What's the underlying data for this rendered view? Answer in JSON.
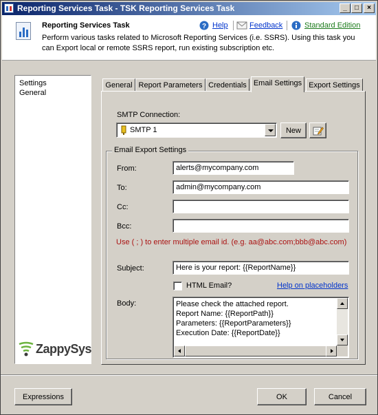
{
  "window": {
    "title": "Reporting Services Task - TSK Reporting Services Task",
    "controls": [
      "_",
      "□",
      "×"
    ]
  },
  "header": {
    "title": "Reporting Services Task",
    "description": "Perform various tasks related to Microsoft Reporting Services (i.e. SSRS). Using this task you can Export local or remote SSRS report, run existing subscription etc.",
    "help_label": "Help",
    "feedback_label": "Feedback",
    "edition_label": "Standard Edition",
    "help_icon": "question-icon",
    "feedback_icon": "envelope-icon",
    "edition_icon": "info-icon"
  },
  "sidebar": {
    "items": [
      {
        "label": "Settings"
      },
      {
        "label": "General"
      }
    ],
    "logo_text": "ZappySys"
  },
  "tabs": [
    {
      "label": "General"
    },
    {
      "label": "Report Parameters"
    },
    {
      "label": "Credentials"
    },
    {
      "label": "Email Settings",
      "active": true
    },
    {
      "label": "Export Settings"
    }
  ],
  "smtp": {
    "label": "SMTP Connection:",
    "selected": "SMTP 1",
    "new_button": "New",
    "edit_icon": "edit-icon"
  },
  "email": {
    "group_label": "Email Export Settings",
    "from_label": "From:",
    "from_value": "alerts@mycompany.com",
    "to_label": "To:",
    "to_value": "admin@mycompany.com",
    "cc_label": "Cc:",
    "cc_value": "",
    "bcc_label": "Bcc:",
    "bcc_value": "",
    "hint": "Use ( ; ) to enter multiple email id. (e.g. aa@abc.com;bbb@abc.com)",
    "subject_label": "Subject:",
    "subject_value": "Here is your report: {{ReportName}}",
    "html_email_label": "HTML Email?",
    "html_email_checked": false,
    "placeholders_link": "Help on placeholders",
    "body_label": "Body:",
    "body_lines": [
      "Please check the attached report.",
      "Report Name: {{ReportPath}}",
      "Parameters: {{ReportParameters}}",
      "Execution Date: {{ReportDate}}"
    ]
  },
  "footer": {
    "expressions_button": "Expressions",
    "ok_button": "OK",
    "cancel_button": "Cancel"
  },
  "colors": {
    "title_gradient_start": "#0a246a",
    "hint_text": "#aa1111",
    "link": "#0033cc"
  }
}
